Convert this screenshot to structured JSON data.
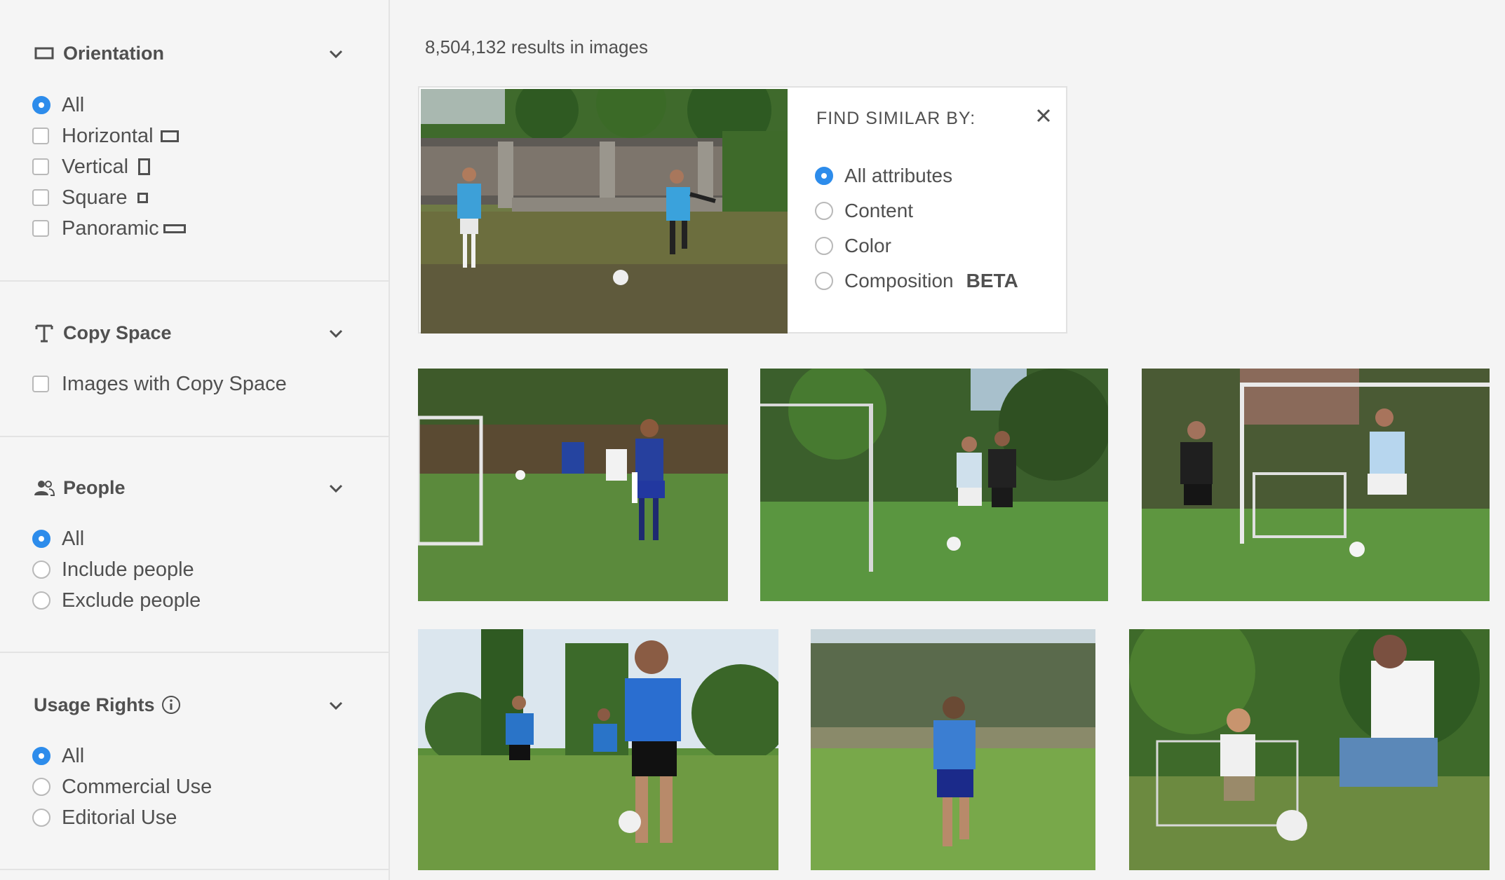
{
  "filters": {
    "orientation": {
      "title": "Orientation",
      "icon": "orientation-icon",
      "options": [
        "All",
        "Horizontal",
        "Vertical",
        "Square",
        "Panoramic"
      ],
      "selected": "All"
    },
    "copy_space": {
      "title": "Copy Space",
      "icon": "text-icon",
      "options": [
        "Images with Copy Space"
      ]
    },
    "people": {
      "title": "People",
      "icon": "people-icon",
      "options": [
        "All",
        "Include people",
        "Exclude people"
      ],
      "selected": "All"
    },
    "usage_rights": {
      "title": "Usage Rights",
      "icon": "info-icon",
      "options": [
        "All",
        "Commercial Use",
        "Editorial Use"
      ],
      "selected": "All"
    }
  },
  "results": {
    "count_text": "8,504,132 results in images"
  },
  "find_similar": {
    "title": "FIND SIMILAR BY:",
    "options": [
      "All attributes",
      "Content",
      "Color",
      "Composition"
    ],
    "selected": "All attributes",
    "beta_label": "BETA"
  },
  "colors": {
    "accent": "#2d8ceb",
    "background": "#f4f4f4",
    "text": "#505050"
  }
}
